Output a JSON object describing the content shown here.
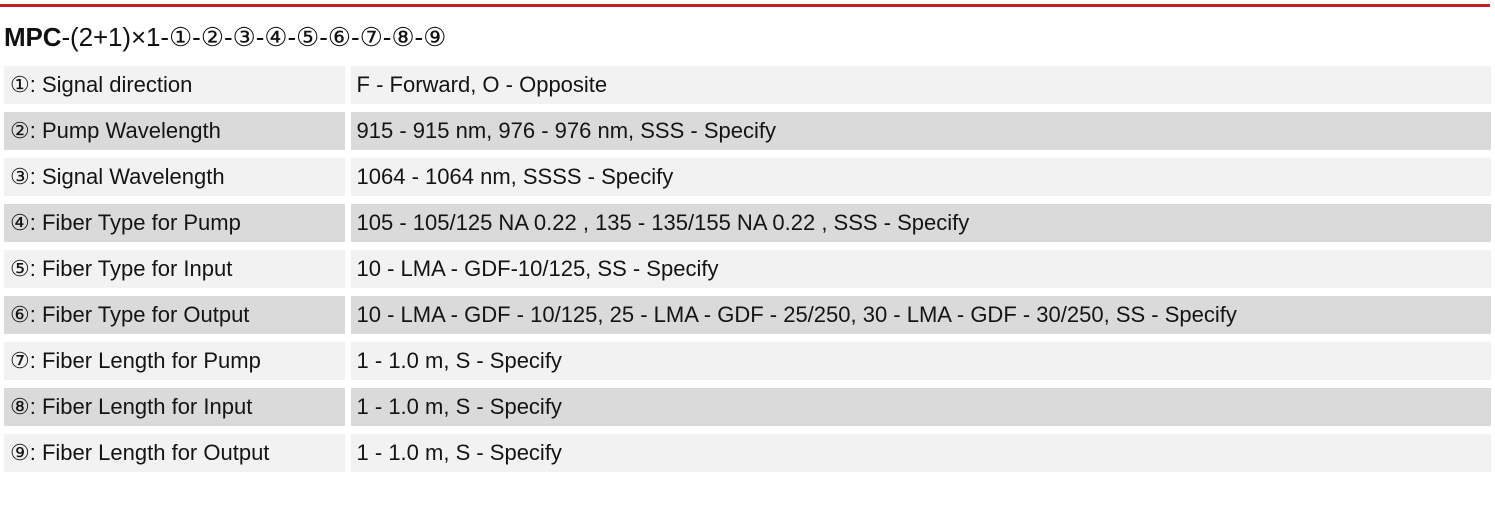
{
  "accent_color": "#bf2026",
  "row_light_color": "#f2f2f2",
  "row_dark_color": "#dadada",
  "header": {
    "brand": "MPC",
    "code_suffix": "-(2+1)×1-①-②-③-④-⑤-⑥-⑦-⑧-⑨",
    "full_code": "MPC-(2+1)×1-①-②-③-④-⑤-⑥-⑦-⑧-⑨"
  },
  "table": {
    "rows": [
      {
        "marker": "①",
        "label": "①: Signal direction",
        "value": "F - Forward, O - Opposite"
      },
      {
        "marker": "②",
        "label": "②: Pump Wavelength",
        "value": "915 - 915 nm, 976 - 976 nm, SSS - Specify"
      },
      {
        "marker": "③",
        "label": "③: Signal Wavelength",
        "value": "1064 - 1064 nm, SSSS - Specify"
      },
      {
        "marker": "④",
        "label": "④: Fiber Type for Pump",
        "value": "105 - 105/125 NA 0.22 , 135 - 135/155 NA 0.22 , SSS - Specify"
      },
      {
        "marker": "⑤",
        "label": "⑤: Fiber Type for Input",
        "value": "10 - LMA - GDF-10/125, SS - Specify"
      },
      {
        "marker": "⑥",
        "label": "⑥: Fiber Type for Output",
        "value": "10 - LMA - GDF - 10/125, 25 - LMA - GDF - 25/250, 30 - LMA - GDF - 30/250, SS - Specify"
      },
      {
        "marker": "⑦",
        "label": "⑦: Fiber Length for Pump",
        "value": "1 - 1.0 m, S - Specify"
      },
      {
        "marker": "⑧",
        "label": "⑧: Fiber Length for Input",
        "value": "1 - 1.0 m, S - Specify"
      },
      {
        "marker": "⑨",
        "label": "⑨: Fiber Length for Output",
        "value": "1 - 1.0 m, S - Specify"
      }
    ]
  }
}
